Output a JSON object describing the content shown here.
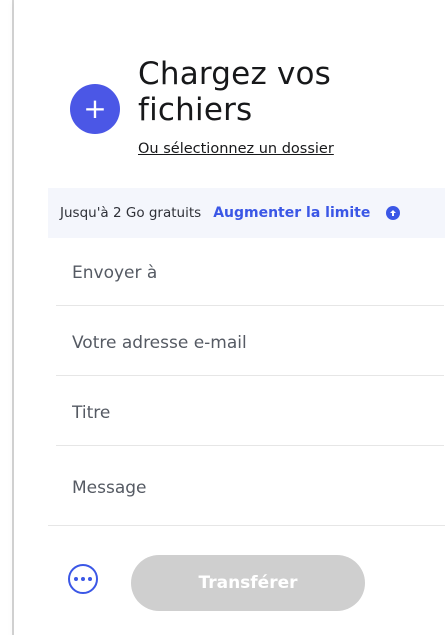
{
  "upload": {
    "title": "Chargez vos\nfichiers",
    "secondary_link": "Ou sélectionnez un dossier",
    "button_icon": "plus-icon"
  },
  "limit": {
    "text": "Jusqu'à 2 Go gratuits",
    "link": "Augmenter la limite",
    "icon": "upgrade-arrow-icon"
  },
  "form": {
    "send_to_placeholder": "Envoyer à",
    "email_placeholder": "Votre adresse e-mail",
    "title_placeholder": "Titre",
    "message_placeholder": "Message"
  },
  "footer": {
    "more_icon": "more-options-icon",
    "transfer_label": "Transférer"
  },
  "colors": {
    "accent": "#4b57e6",
    "link": "#3b57e6",
    "disabled_button": "#cfcfcf",
    "text_dark": "#17181a",
    "text_gray": "#555a63",
    "limit_bar_bg": "#f4f6fc"
  }
}
